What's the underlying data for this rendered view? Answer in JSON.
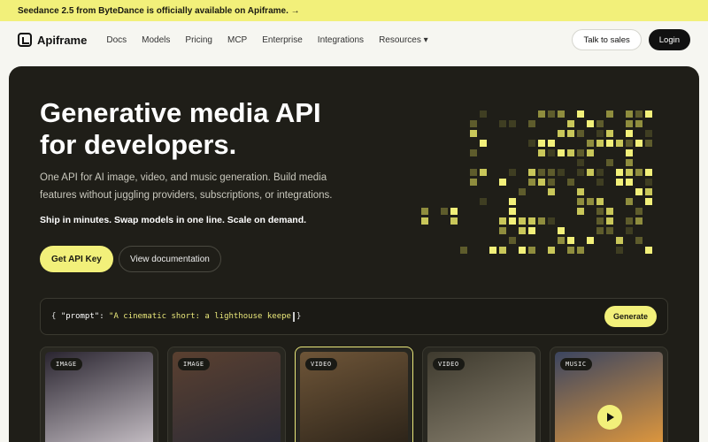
{
  "announcement": {
    "text": "Seedance 2.5 from ByteDance is officially available on Apiframe. →"
  },
  "nav": {
    "brand": "Apiframe",
    "links": [
      "Docs",
      "Models",
      "Pricing",
      "MCP",
      "Enterprise",
      "Integrations",
      "Resources ▾"
    ],
    "talk_to_sales": "Talk to sales",
    "login": "Login"
  },
  "hero": {
    "title_line1": "Generative media API",
    "title_line2": "for developers.",
    "subtitle": "One API for AI image, video, and music generation. Build media features without juggling providers, subscriptions, or integrations.",
    "tagline": "Ship in minutes. Swap models in one line. Scale on demand.",
    "primary_cta": "Get API Key",
    "secondary_cta": "View documentation"
  },
  "prompt": {
    "open_brace": "{",
    "key": "\"prompt\":",
    "value": "\"A cinematic short: a lighthouse keepe",
    "close_brace": "}",
    "generate_label": "Generate"
  },
  "cards": [
    {
      "badge": "IMAGE",
      "gradient": [
        "#2a2530",
        "#c9c2c8"
      ]
    },
    {
      "badge": "IMAGE",
      "gradient": [
        "#5a4030",
        "#2a2a36"
      ]
    },
    {
      "badge": "VIDEO",
      "gradient": [
        "#6e5538",
        "#2a2218"
      ]
    },
    {
      "badge": "VIDEO",
      "gradient": [
        "#3e3a2e",
        "#8a8270"
      ]
    },
    {
      "badge": "MUSIC",
      "gradient": [
        "#3b4560",
        "#e49a3c"
      ]
    }
  ],
  "colors": {
    "accent": "#f2f07a",
    "hero_bg": "#1f1e18"
  }
}
